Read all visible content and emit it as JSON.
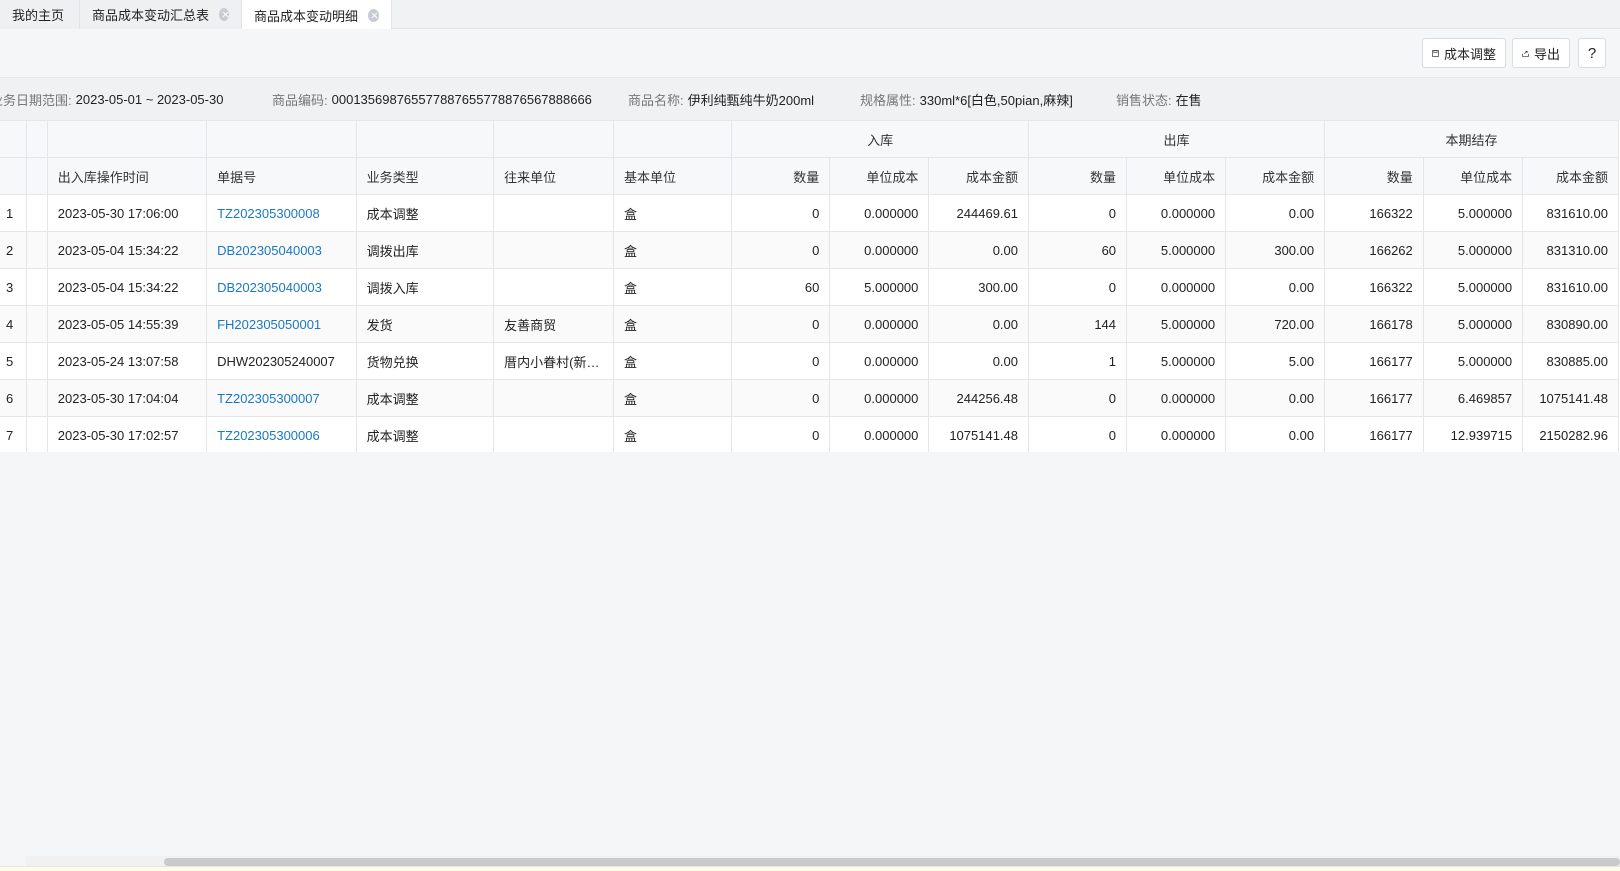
{
  "tabs": [
    {
      "label": "我的主页",
      "closable": false,
      "active": false
    },
    {
      "label": "商品成本变动汇总表",
      "closable": true,
      "active": false
    },
    {
      "label": "商品成本变动明细",
      "closable": true,
      "active": true
    }
  ],
  "toolbar": {
    "adjust_label": "成本调整",
    "export_label": "导出",
    "help_label": "?"
  },
  "info": {
    "date_label": "业务日期范围:",
    "date_value": "2023-05-01 ~ 2023-05-30",
    "code_label": "商品编码:",
    "code_value": "00013569876557788765577887656788866​6",
    "name_label": "商品名称:",
    "name_value": "伊利纯甄纯牛奶200ml",
    "spec_label": "规格属性:",
    "spec_value": "330ml*6[白色,50pian,麻辣]",
    "status_label": "销售状态:",
    "status_value": "在售"
  },
  "table": {
    "groups": {
      "in": "入库",
      "out": "出库",
      "balance": "本期结存"
    },
    "columns": {
      "time": "出入库操作时间",
      "doc": "单据号",
      "type": "业务类型",
      "partner": "往来单位",
      "unit": "基本单位",
      "qty": "数量",
      "unit_cost": "单位成本",
      "amount": "成本金额"
    },
    "rows": [
      {
        "idx": "1",
        "time": "2023-05-30 17:06:00",
        "doc": "TZ202305300008",
        "doc_link": true,
        "type": "成本调整",
        "partner": "",
        "unit": "盒",
        "in_qty": "0",
        "in_cost": "0.000000",
        "in_amt": "244469.61",
        "out_qty": "0",
        "out_cost": "0.000000",
        "out_amt": "0.00",
        "bal_qty": "166322",
        "bal_cost": "5.000000",
        "bal_amt": "831610.00"
      },
      {
        "idx": "2",
        "time": "2023-05-04 15:34:22",
        "doc": "DB202305040003",
        "doc_link": true,
        "type": "调拨出库",
        "partner": "",
        "unit": "盒",
        "in_qty": "0",
        "in_cost": "0.000000",
        "in_amt": "0.00",
        "out_qty": "60",
        "out_cost": "5.000000",
        "out_amt": "300.00",
        "bal_qty": "166262",
        "bal_cost": "5.000000",
        "bal_amt": "831310.00"
      },
      {
        "idx": "3",
        "time": "2023-05-04 15:34:22",
        "doc": "DB202305040003",
        "doc_link": true,
        "type": "调拨入库",
        "partner": "",
        "unit": "盒",
        "in_qty": "60",
        "in_cost": "5.000000",
        "in_amt": "300.00",
        "out_qty": "0",
        "out_cost": "0.000000",
        "out_amt": "0.00",
        "bal_qty": "166322",
        "bal_cost": "5.000000",
        "bal_amt": "831610.00"
      },
      {
        "idx": "4",
        "time": "2023-05-05 14:55:39",
        "doc": "FH202305050001",
        "doc_link": true,
        "type": "发货",
        "partner": "友善商贸",
        "unit": "盒",
        "in_qty": "0",
        "in_cost": "0.000000",
        "in_amt": "0.00",
        "out_qty": "144",
        "out_cost": "5.000000",
        "out_amt": "720.00",
        "bal_qty": "166178",
        "bal_cost": "5.000000",
        "bal_amt": "830890.00"
      },
      {
        "idx": "5",
        "time": "2023-05-24 13:07:58",
        "doc": "DHW202305240007",
        "doc_link": false,
        "type": "货物兑换",
        "partner": "厝内小眷村(新…",
        "unit": "盒",
        "in_qty": "0",
        "in_cost": "0.000000",
        "in_amt": "0.00",
        "out_qty": "1",
        "out_cost": "5.000000",
        "out_amt": "5.00",
        "bal_qty": "166177",
        "bal_cost": "5.000000",
        "bal_amt": "830885.00"
      },
      {
        "idx": "6",
        "time": "2023-05-30 17:04:04",
        "doc": "TZ202305300007",
        "doc_link": true,
        "type": "成本调整",
        "partner": "",
        "unit": "盒",
        "in_qty": "0",
        "in_cost": "0.000000",
        "in_amt": "244256.48",
        "out_qty": "0",
        "out_cost": "0.000000",
        "out_amt": "0.00",
        "bal_qty": "166177",
        "bal_cost": "6.469857",
        "bal_amt": "1075141.48"
      },
      {
        "idx": "7",
        "time": "2023-05-30 17:02:57",
        "doc": "TZ202305300006",
        "doc_link": true,
        "type": "成本调整",
        "partner": "",
        "unit": "盒",
        "in_qty": "0",
        "in_cost": "0.000000",
        "in_amt": "1075141.48",
        "out_qty": "0",
        "out_cost": "0.000000",
        "out_amt": "0.00",
        "bal_qty": "166177",
        "bal_cost": "12.939715",
        "bal_amt": "2150282.96"
      }
    ]
  },
  "colors": {
    "link": "#1a78c2",
    "border": "#e4e6ea",
    "background": "#f5f6f8"
  }
}
